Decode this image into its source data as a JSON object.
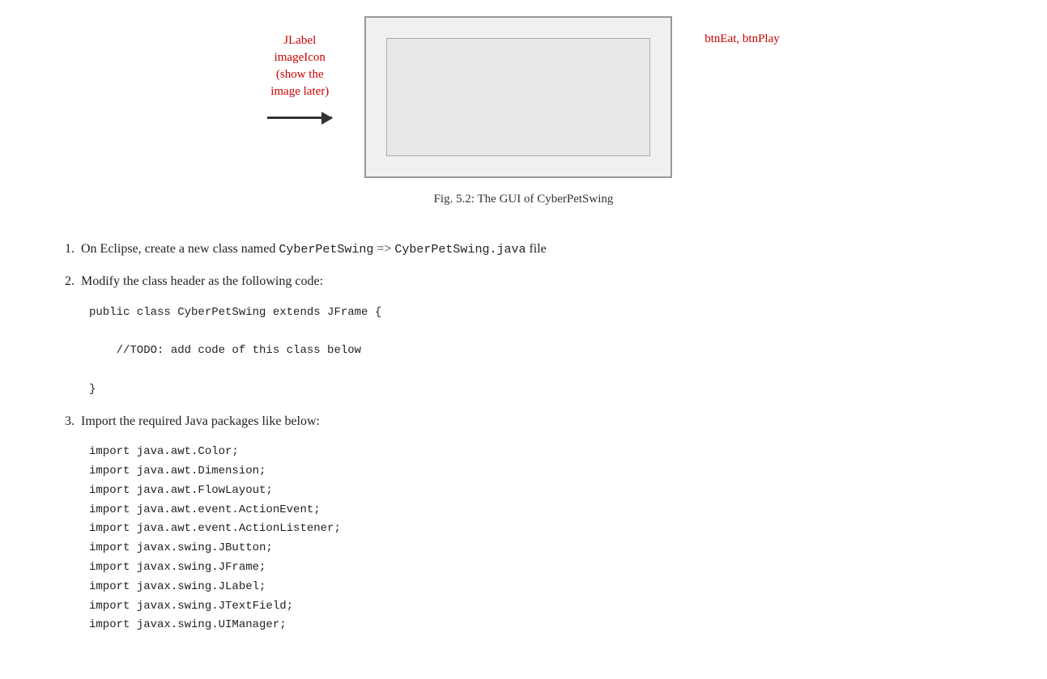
{
  "figure": {
    "caption": "Fig. 5.2: The GUI of CyberPetSwing",
    "left_label_line1": "JLabel",
    "left_label_line2": "imageIcon",
    "left_label_line3": "(show the",
    "left_label_line4": "image later)",
    "right_label": "btnEat, btnPlay"
  },
  "steps": [
    {
      "number": "1.",
      "text_before": "On Eclipse, create a new class named ",
      "code1": "CyberPetSwing",
      "text_middle": " => ",
      "code2": "CyberPetSwing.java",
      "text_after": " file"
    },
    {
      "number": "2.",
      "text": "Modify the class header as the following code:"
    },
    {
      "number": "3.",
      "text": "Import the required Java packages like below:"
    }
  ],
  "code_block_1": "public class CyberPetSwing extends JFrame {\n\n    //TODO: add code of this class below\n\n}",
  "code_block_2": "import java.awt.Color;\nimport java.awt.Dimension;\nimport java.awt.FlowLayout;\nimport java.awt.event.ActionEvent;\nimport java.awt.event.ActionListener;\nimport javax.swing.JButton;\nimport javax.swing.JFrame;\nimport javax.swing.JLabel;\nimport javax.swing.JTextField;\nimport javax.swing.UIManager;"
}
